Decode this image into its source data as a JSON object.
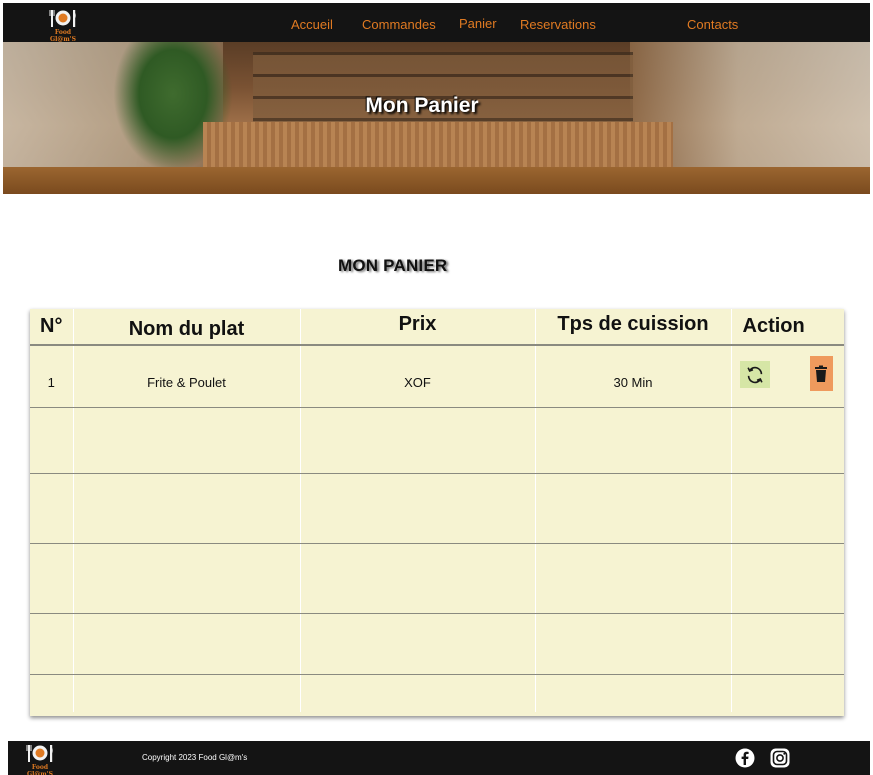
{
  "brand": {
    "name": "Food Gl@m'S"
  },
  "nav": {
    "items": [
      {
        "label": "Accueil"
      },
      {
        "label": "Commandes"
      },
      {
        "label": "Panier"
      },
      {
        "label": "Reservations"
      },
      {
        "label": "Contacts"
      }
    ]
  },
  "hero": {
    "title": "Mon Panier"
  },
  "cart": {
    "heading": "MON PANIER",
    "columns": [
      "N°",
      "Nom du plat",
      "Prix",
      "Tps de cuission",
      "Action"
    ],
    "rows": [
      {
        "n": "1",
        "dish": "Frite & Poulet",
        "price": "XOF",
        "time": "30 Min"
      }
    ],
    "actions": {
      "refresh_icon": "refresh-icon",
      "delete_icon": "trash-icon"
    }
  },
  "footer": {
    "copyright": "Copyright 2023  Food Gl@m's",
    "social": [
      "facebook-icon",
      "instagram-icon"
    ]
  },
  "colors": {
    "accent": "#e07a22",
    "header_bg": "#141414",
    "table_bg": "#f6f3d2",
    "refresh_bg": "#d6e6a6",
    "delete_bg": "#ef9a5d"
  }
}
